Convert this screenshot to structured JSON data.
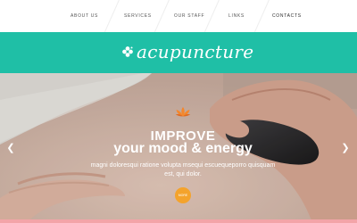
{
  "nav": {
    "items": [
      {
        "label": "ABOUT US"
      },
      {
        "label": "SERVICES"
      },
      {
        "label": "OUR STAFF"
      },
      {
        "label": "LINKS"
      },
      {
        "label": "CONTACTS"
      }
    ]
  },
  "logo": {
    "text": "acupuncture",
    "icon": "flower-icon"
  },
  "hero": {
    "icon": "lotus-icon",
    "heading": "IMPROVE",
    "subheading": "your mood & energy",
    "description": "magni doloresqui ratione volupta msequi escuequeporro quisquam est, qui dolor.",
    "button_label": "MORE",
    "prev_icon": "chevron-left-icon",
    "next_icon": "chevron-right-icon"
  },
  "colors": {
    "accent": "#1fbfa6",
    "button": "#f4a32c",
    "bottom_line": "#f3a4a8"
  }
}
